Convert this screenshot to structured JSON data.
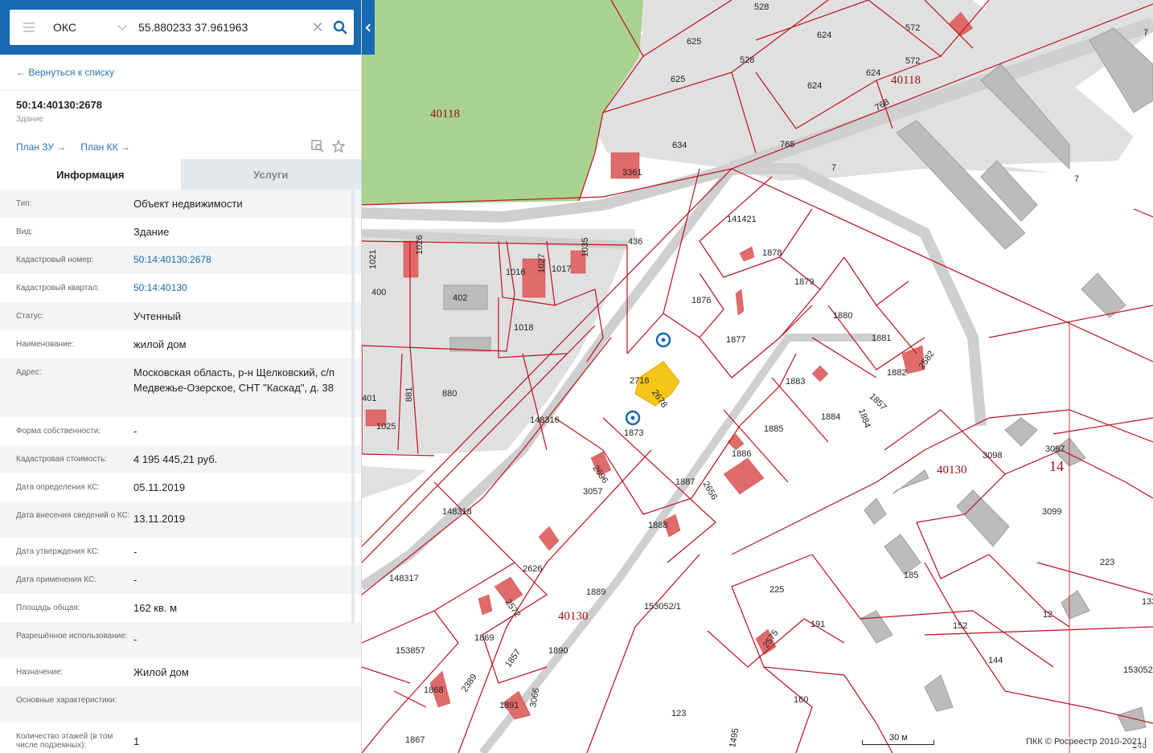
{
  "search": {
    "type_value": "ОКС",
    "query": "55.880233 37.961963",
    "clear_icon": "close-icon",
    "search_icon": "search-icon"
  },
  "panel": {
    "back_link": "← Вернуться к списку",
    "object_number": "50:14:40130:2678",
    "object_type": "Здание",
    "plan_zu": "План ЗУ →",
    "plan_kk": "План КК →",
    "tabs": [
      "Информация",
      "Услуги"
    ],
    "fields": [
      {
        "label": "Тип:",
        "value": "Объект недвижимости"
      },
      {
        "label": "Вид:",
        "value": "Здание"
      },
      {
        "label": "Кадастровый номер:",
        "value": "50:14:40130:2678"
      },
      {
        "label": "Кадастровый квартал:",
        "value": "50:14:40130"
      },
      {
        "label": "Статус:",
        "value": "Учтенный"
      },
      {
        "label": "Наименование:",
        "value": "жилой дом"
      },
      {
        "label": "Адрес:",
        "value": "Московская область, р-н Щелковский, с/п Медвежье-Озерское, СНТ \"Каскад\", д. 38"
      },
      {
        "label": "Форма собственности:",
        "value": "-"
      },
      {
        "label": "Кадастровая стоимость:",
        "value": "4 195 445,21 руб."
      },
      {
        "label": "Дата определения КС:",
        "value": "05.11.2019"
      },
      {
        "label": "Дата внесения сведений о КС:",
        "value": "13.11.2019"
      },
      {
        "label": "Дата утверждения КС:",
        "value": "-"
      },
      {
        "label": "Дата применения КС:",
        "value": "-"
      },
      {
        "label": "Площадь общая:",
        "value": "162 кв. м"
      },
      {
        "label": "Разрешённое использование:",
        "value": "-"
      },
      {
        "label": "Назначение:",
        "value": "Жилой дом"
      },
      {
        "label": "Основные характеристики:",
        "value": ""
      },
      {
        "label": "Количество этажей (в том числе подземных):",
        "value": "1"
      }
    ]
  },
  "map": {
    "footer": "ПКК © Росреестр 2010-2021 |",
    "scale": "30 м",
    "labels": [
      "528",
      "625",
      "625",
      "624",
      "624",
      "572",
      "572",
      "624",
      "40118",
      "768",
      "7",
      "7",
      "40118",
      "634",
      "3361",
      "528",
      "768",
      "7",
      "141421",
      "1878",
      "1879",
      "1880",
      "1881",
      "2582",
      "1882",
      "1876",
      "1877",
      "1883",
      "1884",
      "1857",
      "1884",
      "1885",
      "1886",
      "2656",
      "1887",
      "1888",
      "2716",
      "2678",
      "1873",
      "148316",
      "2696",
      "3057",
      "148318",
      "2626",
      "2572",
      "148317",
      "1889",
      "40130",
      "153052/1",
      "153857",
      "1869",
      "1857",
      "1890",
      "1868",
      "2389",
      "1891",
      "3066",
      "1867",
      "123",
      "1495",
      "436",
      "1021",
      "1026",
      "400",
      "402",
      "1016",
      "1027",
      "1017",
      "1035",
      "1018",
      "881",
      "880",
      "1025",
      "401",
      "3098",
      "3097",
      "40130",
      "14",
      "3099",
      "223",
      "185",
      "225",
      "191",
      "152",
      "12",
      "144",
      "2575",
      "160",
      "153052/",
      "133",
      "146"
    ],
    "colors": {
      "parcel_line": "#c0101c",
      "road": "#d9d9d9",
      "block": "#e0e0e0",
      "park": "#a9d28f",
      "building_red": "#e06b6b",
      "building_grey": "#bcbcbc",
      "selected": "#f5c518",
      "panel_header": "#1669b3",
      "link": "#2a74b5"
    }
  }
}
